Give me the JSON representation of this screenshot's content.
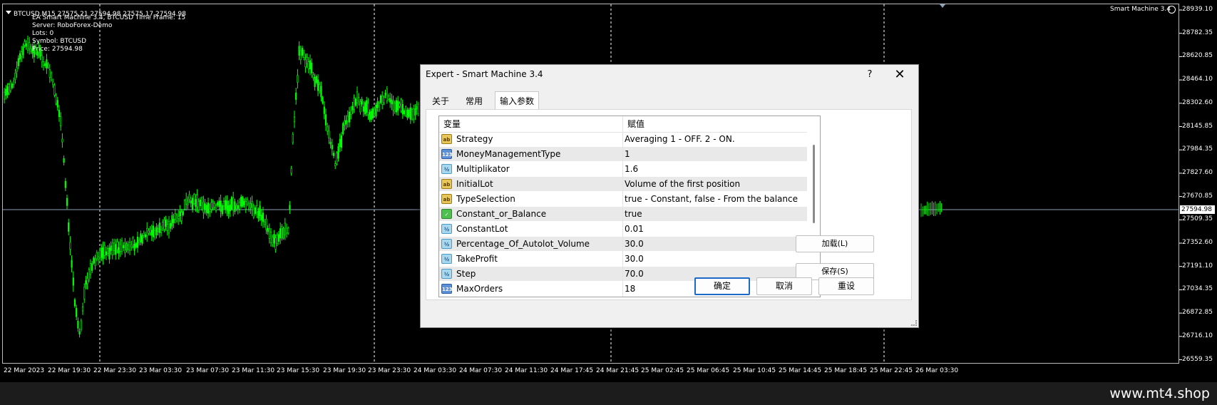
{
  "chart": {
    "title": "BTCUSD,M15  27575.21 27594.98 27575.17 27594.98",
    "info_lines": [
      "EA Smart Machine 3.4, BTCUSD  Time Frame: 15",
      "Server: RoboForex-Demo",
      "Lots:  0",
      "Symbol: BTCUSD",
      "Price:  27594.98"
    ],
    "ea_label": "Smart Machine 3.4",
    "current_price": "27594.98",
    "price_axis": [
      "28939.10",
      "28782.35",
      "28620.85",
      "28464.10",
      "28302.60",
      "28145.85",
      "27984.35",
      "27827.60",
      "27670.85",
      "27509.35",
      "27352.60",
      "27191.10",
      "27034.35",
      "26872.85",
      "26716.10",
      "26559.35"
    ],
    "time_axis": [
      "22 Mar 2023",
      "22 Mar 19:30",
      "22 Mar 23:30",
      "23 Mar 03:30",
      "23 Mar 07:30",
      "23 Mar 11:30",
      "23 Mar 15:30",
      "23 Mar 19:30",
      "23 Mar 23:30",
      "24 Mar 03:30",
      "24 Mar 07:30",
      "24 Mar 11:30",
      "24 Mar 17:45",
      "24 Mar 21:45",
      "25 Mar 02:45",
      "25 Mar 06:45",
      "25 Mar 10:45",
      "25 Mar 14:45",
      "25 Mar 18:45",
      "25 Mar 22:45",
      "26 Mar 03:30"
    ],
    "colors": {
      "candle": "#00ff00",
      "background": "#000000",
      "grid": "#ffffff"
    }
  },
  "dialog": {
    "title": "Expert - Smart Machine 3.4",
    "help_label": "?",
    "close_label": "✕",
    "tabs": [
      {
        "label": "关于",
        "active": false
      },
      {
        "label": "常用",
        "active": false
      },
      {
        "label": "输入参数",
        "active": true
      }
    ],
    "table": {
      "headers": [
        "变量",
        "赋值"
      ],
      "rows": [
        {
          "type": "ab",
          "type_label": "ab",
          "name": "Strategy",
          "value": "Averaging 1 - OFF. 2 - ON."
        },
        {
          "type": "int",
          "type_label": "123",
          "name": "MoneyManagementType",
          "value": "1"
        },
        {
          "type": "dbl",
          "type_label": "½",
          "name": "Multiplikator",
          "value": "1.6"
        },
        {
          "type": "ab",
          "type_label": "ab",
          "name": "InitialLot",
          "value": "Volume of the first position"
        },
        {
          "type": "ab",
          "type_label": "ab",
          "name": "TypeSelection",
          "value": "true - Constant, false - From the balance"
        },
        {
          "type": "bool",
          "type_label": "✓",
          "name": "Constant_or_Balance",
          "value": "true"
        },
        {
          "type": "dbl",
          "type_label": "½",
          "name": "ConstantLot",
          "value": "0.01"
        },
        {
          "type": "dbl",
          "type_label": "½",
          "name": "Percentage_Of_Autolot_Volume",
          "value": "30.0"
        },
        {
          "type": "dbl",
          "type_label": "½",
          "name": "TakeProfit",
          "value": "30.0"
        },
        {
          "type": "dbl",
          "type_label": "½",
          "name": "Step",
          "value": "70.0"
        },
        {
          "type": "int",
          "type_label": "123",
          "name": "MaxOrders",
          "value": "18"
        }
      ]
    },
    "load_label": "加载(L)",
    "save_label": "保存(S)",
    "ok_label": "确定",
    "cancel_label": "取消",
    "reset_label": "重设"
  },
  "footer": {
    "text": "www.mt4.shop"
  }
}
